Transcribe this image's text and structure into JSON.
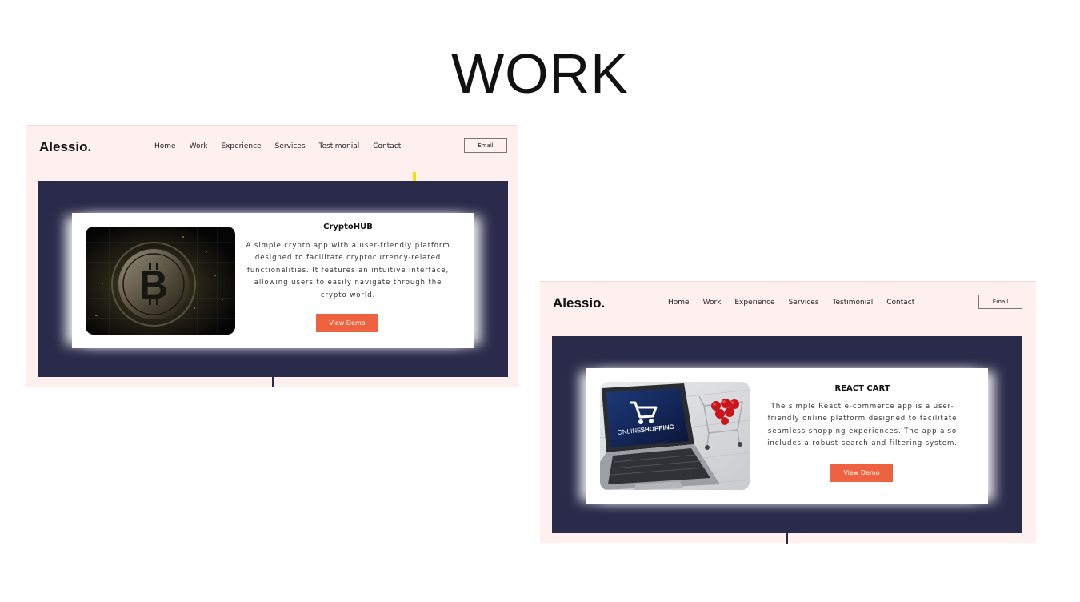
{
  "page_title": "WORK",
  "projects": [
    {
      "logo": "Alessio.",
      "nav": [
        "Home",
        "Work",
        "Experience",
        "Services",
        "Testimonial",
        "Contact"
      ],
      "email_label": "Email",
      "card": {
        "title": "CryptoHUB",
        "description": "A simple crypto app with a user-friendly platform designed to facilitate cryptocurrency-related functionalities. It features an intuitive interface, allowing users to easily navigate through the crypto world.",
        "button_label": "View Demo",
        "image_icon": "bitcoin-image"
      }
    },
    {
      "logo": "Alessio.",
      "nav": [
        "Home",
        "Work",
        "Experience",
        "Services",
        "Testimonial",
        "Contact"
      ],
      "email_label": "Email",
      "card": {
        "title": "REACT CART",
        "description": "The simple React e-commerce app is a user-friendly online platform designed to facilitate seamless shopping experiences. The app also includes a robust search and filtering system.",
        "button_label": "View Demo",
        "image_icon": "online-shopping-image",
        "image_caption_light": "ONLINE",
        "image_caption_bold": "SHOPPING"
      }
    }
  ],
  "colors": {
    "accent": "#ee6240",
    "panel": "#2a2b4a",
    "header_bg": "#fdf0ef",
    "indicator": "#f5e000"
  }
}
